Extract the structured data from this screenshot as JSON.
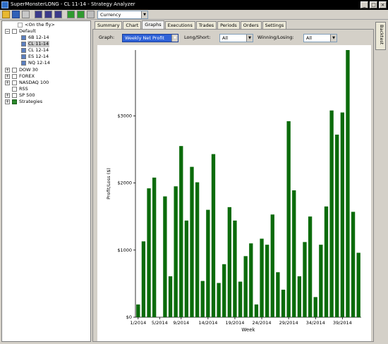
{
  "window": {
    "title": "SuperMonsterLONG - CL 11-14 - Strategy Analyzer"
  },
  "toolbar": {
    "currency_combo": "Currency"
  },
  "tree": {
    "items": [
      {
        "label": "<On the fly>"
      },
      {
        "label": "Default"
      },
      {
        "label": "6B 12-14"
      },
      {
        "label": "CL 11-14"
      },
      {
        "label": "CL 12-14"
      },
      {
        "label": "ES 12-14"
      },
      {
        "label": "NQ 12-14"
      },
      {
        "label": "DOW 30"
      },
      {
        "label": "FOREX"
      },
      {
        "label": "NASDAQ 100"
      },
      {
        "label": "RSS"
      },
      {
        "label": "SP 500"
      },
      {
        "label": "Strategies"
      }
    ]
  },
  "tabs": [
    "Summary",
    "Chart",
    "Graphs",
    "Executions",
    "Trades",
    "Periods",
    "Orders",
    "Settings"
  ],
  "filters": {
    "graph_label": "Graph:",
    "graph_value": "Weekly Net Profit",
    "long_short_label": "Long/Short:",
    "long_short_value": "All",
    "win_lose_label": "Winning/Losing:",
    "win_lose_value": "All"
  },
  "side_tab": {
    "label": "Backtest"
  },
  "colors": {
    "bar": "#0b6b0b"
  },
  "chart_data": {
    "type": "bar",
    "xlabel": "Week",
    "ylabel": "Profit/Loss ($)",
    "ylim": [
      0,
      3980
    ],
    "yticks": [
      0,
      1000,
      2000,
      3000
    ],
    "ytick_labels": [
      "$0",
      "$1000",
      "$2000",
      "$3000"
    ],
    "xtick_labels": [
      "1/2014",
      "5/2014",
      "9/2014",
      "14/2014",
      "19/2014",
      "24/2014",
      "29/2014",
      "34/2014",
      "39/2014"
    ],
    "xtick_week": [
      1,
      5,
      9,
      14,
      19,
      24,
      29,
      34,
      39
    ],
    "weeks": [
      1,
      2,
      3,
      4,
      5,
      6,
      7,
      8,
      9,
      10,
      11,
      12,
      13,
      14,
      15,
      16,
      17,
      18,
      19,
      20,
      21,
      22,
      23,
      24,
      25,
      26,
      27,
      28,
      29,
      30,
      31,
      32,
      33,
      34,
      35,
      36,
      37,
      38,
      39,
      40,
      41
    ],
    "values": [
      190,
      1130,
      1920,
      2080,
      0,
      1800,
      610,
      1950,
      2550,
      1440,
      2240,
      2010,
      540,
      1600,
      2430,
      510,
      790,
      1640,
      1440,
      530,
      910,
      1100,
      190,
      1170,
      1080,
      1530,
      670,
      410,
      2920,
      1890,
      610,
      1120,
      1500,
      300,
      1080,
      1650,
      3080,
      2720,
      3050,
      3980,
      1570,
      960
    ]
  }
}
